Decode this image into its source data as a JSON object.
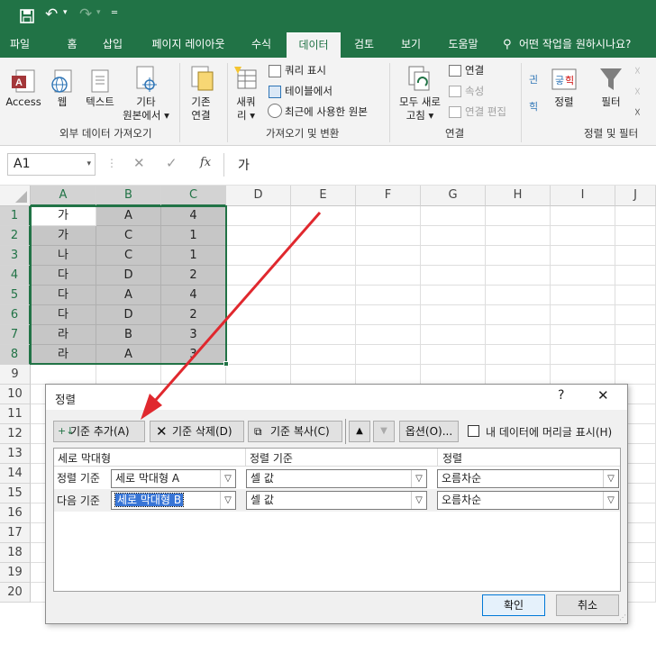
{
  "ribbon_tabs": [
    "파일",
    "홈",
    "삽입",
    "페이지 레이아웃",
    "수식",
    "데이터",
    "검토",
    "보기",
    "도움말"
  ],
  "tell_me": "어떤 작업을 원하시나요?",
  "ribbon": {
    "access": "Access",
    "web": "웹",
    "text": "텍스트",
    "other_line1": "기타",
    "other_line2": "원본에서 ▾",
    "existing_line1": "기존",
    "existing_line2": "연결",
    "new_query_line1": "새쿼",
    "new_query_line2": "리 ▾",
    "show_queries": "쿼리 표시",
    "from_table": "테이블에서",
    "recent_sources": "최근에 사용한 원본",
    "refresh_line1": "모두 새로",
    "refresh_line2": "고침 ▾",
    "connections": "연결",
    "properties": "속성",
    "edit_links": "연결 편집",
    "sort": "정렬",
    "filter": "필터",
    "group_external": "외부 데이터 가져오기",
    "group_get_transform": "가져오기 및 변환",
    "group_connections": "연결",
    "group_sort_filter": "정렬 및 필터"
  },
  "formula": {
    "name_box": "A1",
    "value": "가",
    "fx": "fx"
  },
  "columns": [
    "A",
    "B",
    "C",
    "D",
    "E",
    "F",
    "G",
    "H",
    "I",
    "J"
  ],
  "rows": [
    "1",
    "2",
    "3",
    "4",
    "5",
    "6",
    "7",
    "8",
    "9",
    "10",
    "11",
    "12",
    "13",
    "14",
    "15",
    "16",
    "17",
    "18",
    "19",
    "20"
  ],
  "cells": [
    [
      "가",
      "A",
      "4"
    ],
    [
      "가",
      "C",
      "1"
    ],
    [
      "나",
      "C",
      "1"
    ],
    [
      "다",
      "D",
      "2"
    ],
    [
      "다",
      "A",
      "4"
    ],
    [
      "다",
      "D",
      "2"
    ],
    [
      "라",
      "B",
      "3"
    ],
    [
      "라",
      "A",
      "3"
    ]
  ],
  "dialog": {
    "title": "정렬",
    "help": "?",
    "close": "✕",
    "add_level": "기준 추가(A)",
    "delete_level": "기준 삭제(D)",
    "copy_level": "기준 복사(C)",
    "options": "옵션(O)...",
    "my_data_has_headers": "내 데이터에 머리글 표시(H)",
    "header_column": "세로 막대형",
    "header_sort_on": "정렬 기준",
    "header_order": "정렬",
    "row1_label": "정렬 기준",
    "row2_label": "다음 기준",
    "row1_column": "세로 막대형 A",
    "row2_column": "세로 막대형 B",
    "row1_sort_on": "셀 값",
    "row2_sort_on": "셀 값",
    "row1_order": "오름차순",
    "row2_order": "오름차순",
    "ok": "확인",
    "cancel": "취소"
  },
  "colors": {
    "excel_green": "#217346",
    "arrow_red": "#e0282e",
    "selection_gray": "#c6c6c6"
  }
}
